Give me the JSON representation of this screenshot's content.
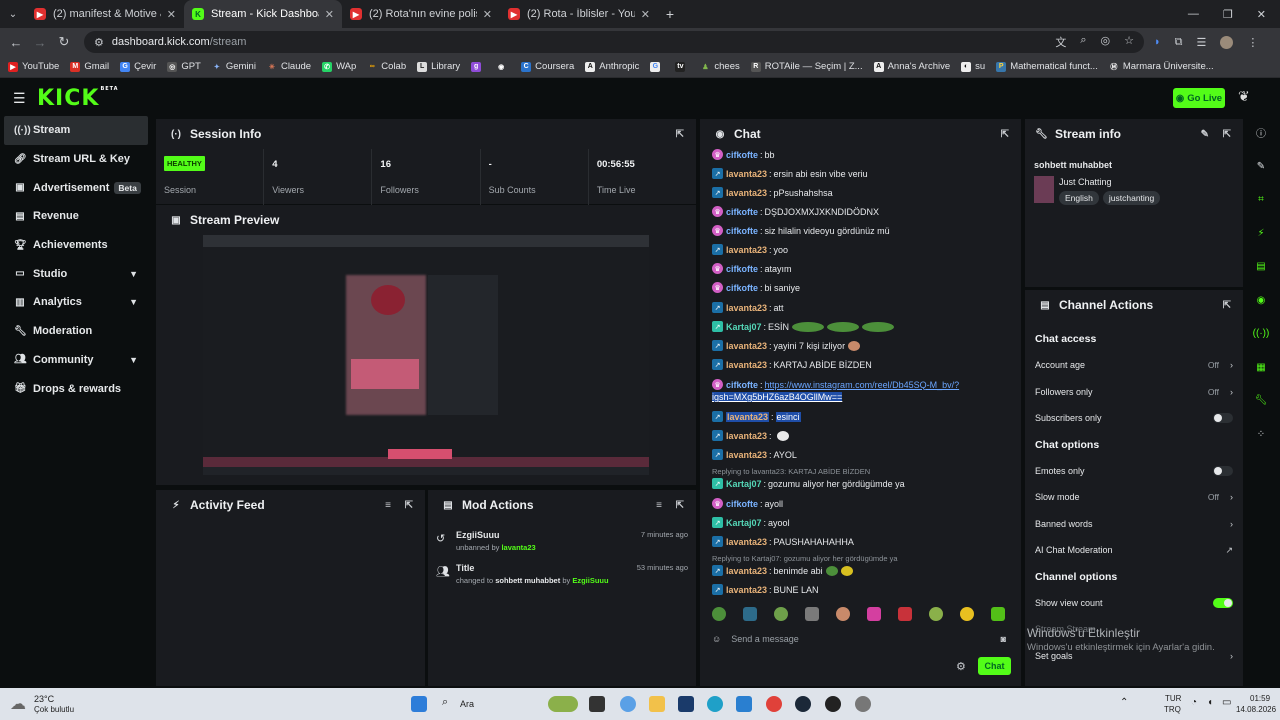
{
  "browser": {
    "tabs": [
      {
        "title": "(2) manifest & Motive & Pangu",
        "icon": "youtube-icon",
        "color": "#e03030",
        "active": false
      },
      {
        "title": "Stream - Kick Dashboard",
        "icon": "kick-icon",
        "color": "#53fc18",
        "active": true
      },
      {
        "title": "(2) Rota'nın evine polis baskını",
        "icon": "youtube-icon",
        "color": "#e03030",
        "active": false
      },
      {
        "title": "(2) Rota - İblisler - YouTube",
        "icon": "youtube-icon",
        "color": "#e03030",
        "active": false
      }
    ],
    "url_host": "dashboard.kick.com",
    "url_path": "/stream",
    "bookmarks": [
      "YouTube",
      "Gmail",
      "Çevir",
      "GPT",
      "Gemini",
      "Claude",
      "WAp",
      "Colab",
      "Library",
      "",
      "",
      "Coursera",
      "Anthropic",
      "",
      "",
      "chees",
      "ROTAile — Seçim | Z...",
      "Anna's Archive",
      "su",
      "Mathematical funct...",
      "Marmara Üniversite..."
    ]
  },
  "header": {
    "logo": "KICK",
    "logo_sup": "BETA",
    "go_live": "Go Live"
  },
  "sidebar": {
    "items": [
      {
        "label": "Stream",
        "icon": "broadcast-icon",
        "active": true
      },
      {
        "label": "Stream URL & Key",
        "icon": "link-icon"
      },
      {
        "label": "Advertisement",
        "icon": "tv-icon",
        "badge": "Beta"
      },
      {
        "label": "Revenue",
        "icon": "chart-icon"
      },
      {
        "label": "Achievements",
        "icon": "trophy-icon"
      },
      {
        "label": "Studio",
        "icon": "monitor-icon",
        "expand": true
      },
      {
        "label": "Analytics",
        "icon": "analytics-icon",
        "expand": true
      },
      {
        "label": "Moderation",
        "icon": "wrench-icon"
      },
      {
        "label": "Community",
        "icon": "people-icon",
        "expand": true
      },
      {
        "label": "Drops & rewards",
        "icon": "gift-icon"
      }
    ]
  },
  "session": {
    "title": "Session Info",
    "stats": [
      {
        "value": "HEALTHY",
        "label": "Session"
      },
      {
        "value": "4",
        "label": "Viewers"
      },
      {
        "value": "16",
        "label": "Followers"
      },
      {
        "value": "-",
        "label": "Sub Counts"
      },
      {
        "value": "00:56:55",
        "label": "Time Live"
      }
    ]
  },
  "preview": {
    "title": "Stream Preview"
  },
  "activity": {
    "title": "Activity Feed"
  },
  "mod": {
    "title": "Mod Actions",
    "items": [
      {
        "user": "EzgiiSuuu",
        "action": "unbanned by",
        "by": "lavanta23",
        "time": "7 minutes ago",
        "icon": "undo-icon"
      },
      {
        "user": "Title",
        "action": "changed to",
        "target": "sohbett muhabbet",
        "by_word": "by",
        "by": "EzgiiSuuu",
        "time": "53 minutes ago",
        "icon": "users-edit-icon"
      }
    ]
  },
  "chat": {
    "title": "Chat",
    "messages": [
      {
        "user": "cifkofte",
        "text": "bb",
        "badge": "p"
      },
      {
        "user": "lavanta23",
        "text": "ersin abi esin vibe veriu",
        "badge": "k"
      },
      {
        "user": "lavanta23",
        "text": "pPsushahshsa",
        "badge": "k"
      },
      {
        "user": "cifkofte",
        "text": "DŞDJOXMXJXKNDIDÖDNX",
        "badge": "p"
      },
      {
        "user": "cifkofte",
        "text": "siz hilalin videoyu gördünüz mü",
        "badge": "p"
      },
      {
        "user": "lavanta23",
        "text": "yoo",
        "badge": "k"
      },
      {
        "user": "cifkofte",
        "text": "atayım",
        "badge": "p"
      },
      {
        "user": "cifkofte",
        "text": "bi saniye",
        "badge": "p"
      },
      {
        "user": "lavanta23",
        "text": "att",
        "badge": "k"
      },
      {
        "user": "Kartaj07",
        "text": "ESİN",
        "badge": "s"
      },
      {
        "user": "lavanta23",
        "text": "yayini 7 kişi izliyor",
        "badge": "k"
      },
      {
        "user": "lavanta23",
        "text": "KARTAJ ABİDE BİZDEN",
        "badge": "k"
      },
      {
        "user": "cifkofte",
        "text": "https://www.instagram.com/reel/Db45SQ-M_bv/?",
        "text2": "igsh=MXg5bHZ6azB4OGllMw==",
        "badge": "p"
      },
      {
        "user": "lavanta23",
        "text": "esinci",
        "badge": "k"
      },
      {
        "user": "lavanta23",
        "text": "",
        "badge": "k"
      },
      {
        "user": "lavanta23",
        "text": "AYOL",
        "badge": "k"
      },
      {
        "reply": "Replying to lavanta23: KARTAJ ABİDE BİZDEN"
      },
      {
        "user": "Kartaj07",
        "text": "gozumu aliyor her gördügümde ya",
        "badge": "s"
      },
      {
        "user": "cifkofte",
        "text": "ayoll",
        "badge": "p"
      },
      {
        "user": "Kartaj07",
        "text": "ayool",
        "badge": "s"
      },
      {
        "user": "lavanta23",
        "text": "PAUSHAHAHAHHA",
        "badge": "k"
      },
      {
        "reply": "Replying to Kartaj07: gozumu aliyor her gördügümde ya"
      },
      {
        "user": "lavanta23",
        "text": "benimde abi",
        "badge": "k"
      },
      {
        "user": "lavanta23",
        "text": "BUNE LAN",
        "badge": "k"
      }
    ],
    "placeholder": "Send a message",
    "send": "Chat"
  },
  "stream_info": {
    "title": "Stream info",
    "stream_title": "sohbett muhabbet",
    "category": "Just Chatting",
    "tags": [
      "English",
      "justchanting"
    ]
  },
  "channel_actions": {
    "title": "Channel Actions",
    "chat_access": "Chat access",
    "rows1": [
      {
        "label": "Account age",
        "value": "Off",
        "type": "chevron"
      },
      {
        "label": "Followers only",
        "value": "Off",
        "type": "chevron"
      },
      {
        "label": "Subscribers only",
        "type": "toggle",
        "on": false
      }
    ],
    "chat_options": "Chat options",
    "rows2": [
      {
        "label": "Emotes only",
        "type": "toggle",
        "on": false
      },
      {
        "label": "Slow mode",
        "value": "Off",
        "type": "chevron"
      },
      {
        "label": "Banned words",
        "type": "chevron"
      },
      {
        "label": "AI Chat Moderation",
        "type": "external"
      }
    ],
    "channel_options": "Channel options",
    "rows3": [
      {
        "label": "Show view count",
        "type": "toggle",
        "on": true
      },
      {
        "label": "Stream Stream",
        "type": "none"
      },
      {
        "label": "Set goals",
        "type": "chevron"
      }
    ]
  },
  "watermark": {
    "line1": "Windows'u Etkinleştir",
    "line2": "Windows'u etkinleştirmek için Ayarlar'a gidin."
  },
  "taskbar": {
    "weather_temp": "23°C",
    "weather_text": "Çok bulutlu",
    "search": "Ara",
    "lang1": "TUR",
    "lang2": "TRQ",
    "time": "01:59",
    "date": "14.08.2026"
  }
}
